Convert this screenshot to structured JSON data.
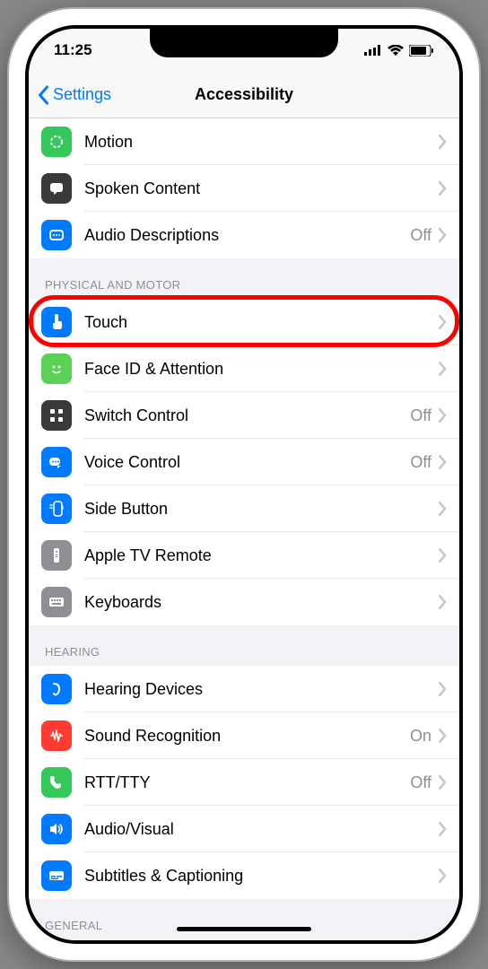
{
  "status": {
    "time": "11:25"
  },
  "nav": {
    "back": "Settings",
    "title": "Accessibility"
  },
  "sections": {
    "top": {
      "items": [
        {
          "label": "Motion",
          "value": "",
          "icon_bg": "ic-green",
          "icon": "motion"
        },
        {
          "label": "Spoken Content",
          "value": "",
          "icon_bg": "ic-dark",
          "icon": "speech"
        },
        {
          "label": "Audio Descriptions",
          "value": "Off",
          "icon_bg": "ic-blue",
          "icon": "audio"
        }
      ]
    },
    "physical": {
      "header": "PHYSICAL AND MOTOR",
      "items": [
        {
          "label": "Touch",
          "value": "",
          "icon_bg": "ic-blue",
          "icon": "touch",
          "highlighted": true
        },
        {
          "label": "Face ID & Attention",
          "value": "",
          "icon_bg": "ic-green2",
          "icon": "face"
        },
        {
          "label": "Switch Control",
          "value": "Off",
          "icon_bg": "ic-dark",
          "icon": "switch"
        },
        {
          "label": "Voice Control",
          "value": "Off",
          "icon_bg": "ic-blue",
          "icon": "voice"
        },
        {
          "label": "Side Button",
          "value": "",
          "icon_bg": "ic-blue",
          "icon": "side"
        },
        {
          "label": "Apple TV Remote",
          "value": "",
          "icon_bg": "ic-gray",
          "icon": "remote"
        },
        {
          "label": "Keyboards",
          "value": "",
          "icon_bg": "ic-gray",
          "icon": "keyboard"
        }
      ]
    },
    "hearing": {
      "header": "HEARING",
      "items": [
        {
          "label": "Hearing Devices",
          "value": "",
          "icon_bg": "ic-blue",
          "icon": "ear"
        },
        {
          "label": "Sound Recognition",
          "value": "On",
          "icon_bg": "ic-red",
          "icon": "wave"
        },
        {
          "label": "RTT/TTY",
          "value": "Off",
          "icon_bg": "ic-green",
          "icon": "phone"
        },
        {
          "label": "Audio/Visual",
          "value": "",
          "icon_bg": "ic-blue",
          "icon": "speaker"
        },
        {
          "label": "Subtitles & Captioning",
          "value": "",
          "icon_bg": "ic-blue",
          "icon": "cc"
        }
      ]
    },
    "general": {
      "header": "GENERAL"
    }
  }
}
